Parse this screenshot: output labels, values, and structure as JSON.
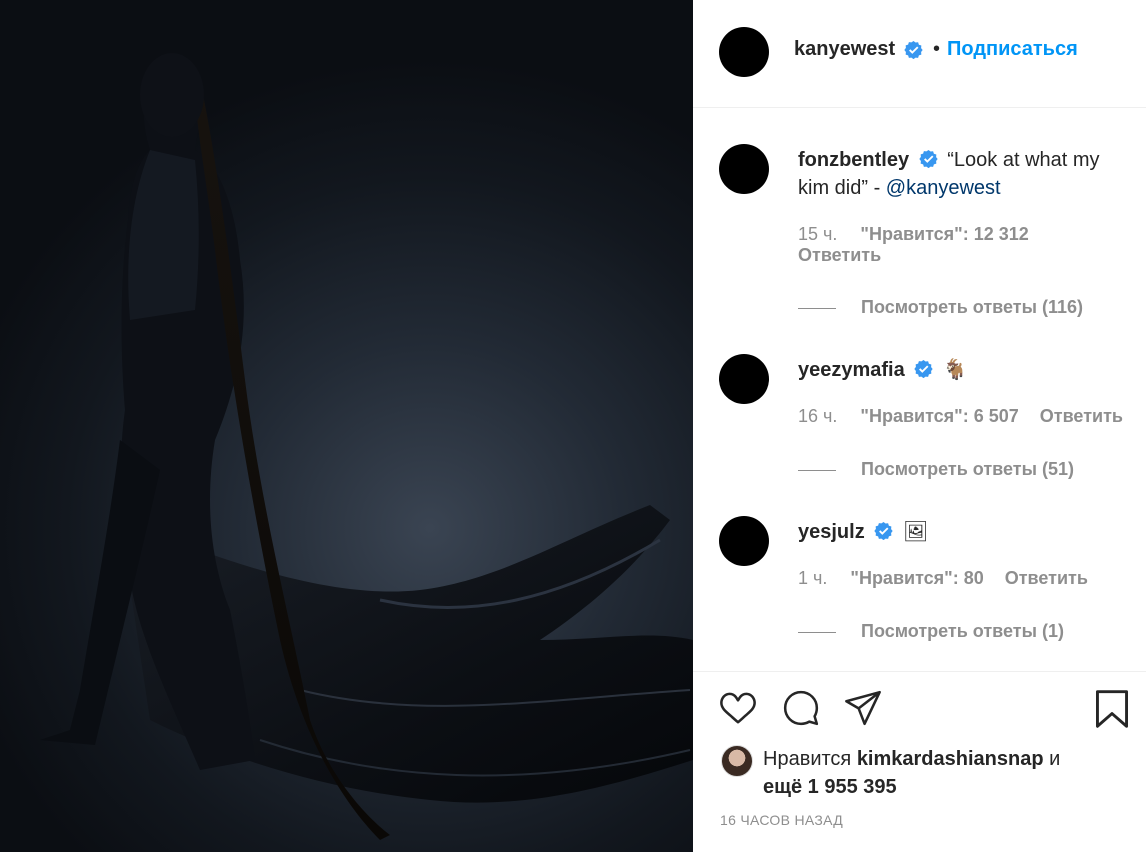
{
  "post": {
    "author": "kanyewest",
    "dot": "•",
    "follow_label": "Подписаться",
    "timestamp": "16 ЧАСОВ НАЗАД"
  },
  "comments": [
    {
      "user": "fonzbentley",
      "text": "“Look at what my kim did” - ",
      "mention": "@kanyewest",
      "time": "15 ч.",
      "likes": "\"Нравится\": 12 312",
      "reply_label": "Ответить",
      "view_replies": "Посмотреть ответы (116)"
    },
    {
      "user": "yeezymafia",
      "text": "🐐",
      "time": "16 ч.",
      "likes": "\"Нравится\": 6 507",
      "reply_label": "Ответить",
      "view_replies": "Посмотреть ответы (51)"
    },
    {
      "user": "yesjulz",
      "text": "🖼",
      "time": "1 ч.",
      "likes": "\"Нравится\": 80",
      "reply_label": "Ответить",
      "view_replies": "Посмотреть ответы (1)"
    }
  ],
  "likes_summary": {
    "prefix": "Нравится ",
    "user": "kimkardashiansnap",
    "suffix": " и",
    "others": "ещё 1 955 395"
  },
  "icons": {
    "like": "heart-icon",
    "comment": "comment-icon",
    "share": "send-icon",
    "save": "bookmark-icon",
    "verified": "verified-badge-icon"
  },
  "colors": {
    "accent": "#0095f6",
    "verified": "#3897f0",
    "mention": "#00376b",
    "muted": "#8e8e8e"
  }
}
